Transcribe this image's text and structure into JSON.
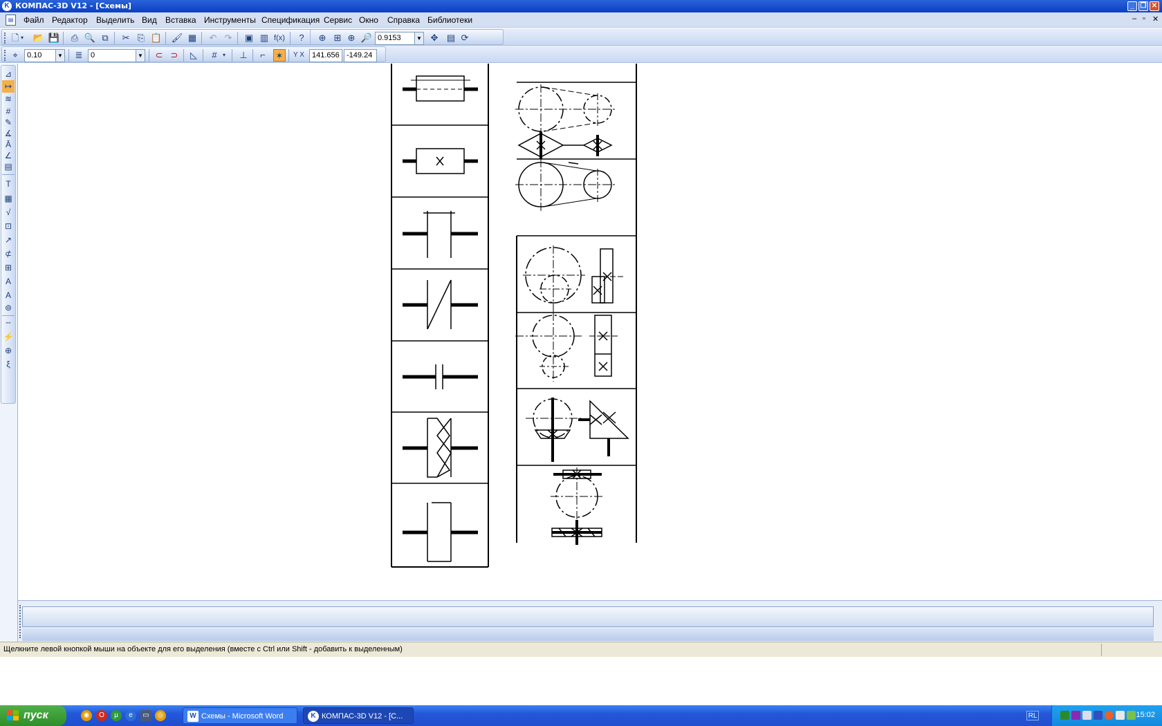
{
  "window": {
    "title": "КОМПАС-3D V12 - [Схемы]",
    "minimize": "_",
    "restore": "❐",
    "close": "✕"
  },
  "menu": [
    {
      "label": "Файл"
    },
    {
      "label": "Редактор"
    },
    {
      "label": "Выделить"
    },
    {
      "label": "Вид"
    },
    {
      "label": "Вставка"
    },
    {
      "label": "Инструменты"
    },
    {
      "label": "Спецификация"
    },
    {
      "label": "Сервис"
    },
    {
      "label": "Окно"
    },
    {
      "label": "Справка"
    },
    {
      "label": "Библиотеки"
    }
  ],
  "mdi_controls": {
    "minimize": "–",
    "restore": "▫",
    "close": "✕"
  },
  "toolbar1": {
    "zoom_value": "0.9153"
  },
  "toolbar2": {
    "step_value": "0.10",
    "layer_value": "0",
    "coord_x": "141.656",
    "coord_y": "-149.24",
    "coord_label": "Y X"
  },
  "status": {
    "hint": "Щелкните левой кнопкой мыши на объекте для его выделения (вместе с Ctrl или Shift - добавить к выделенным)"
  },
  "taskbar": {
    "start_label": "пуск",
    "tasks": [
      {
        "label": "Схемы - Microsoft Word",
        "icon": "W"
      },
      {
        "label": "КОМПАС-3D V12 - [С...",
        "icon": "K"
      }
    ],
    "language": "RL",
    "clock": "15:02"
  },
  "colors": {
    "titlebar": "#0a3fc4",
    "toolbar": "#c9d8f1",
    "taskbar": "#2457d9",
    "start": "#2e8f2a"
  }
}
